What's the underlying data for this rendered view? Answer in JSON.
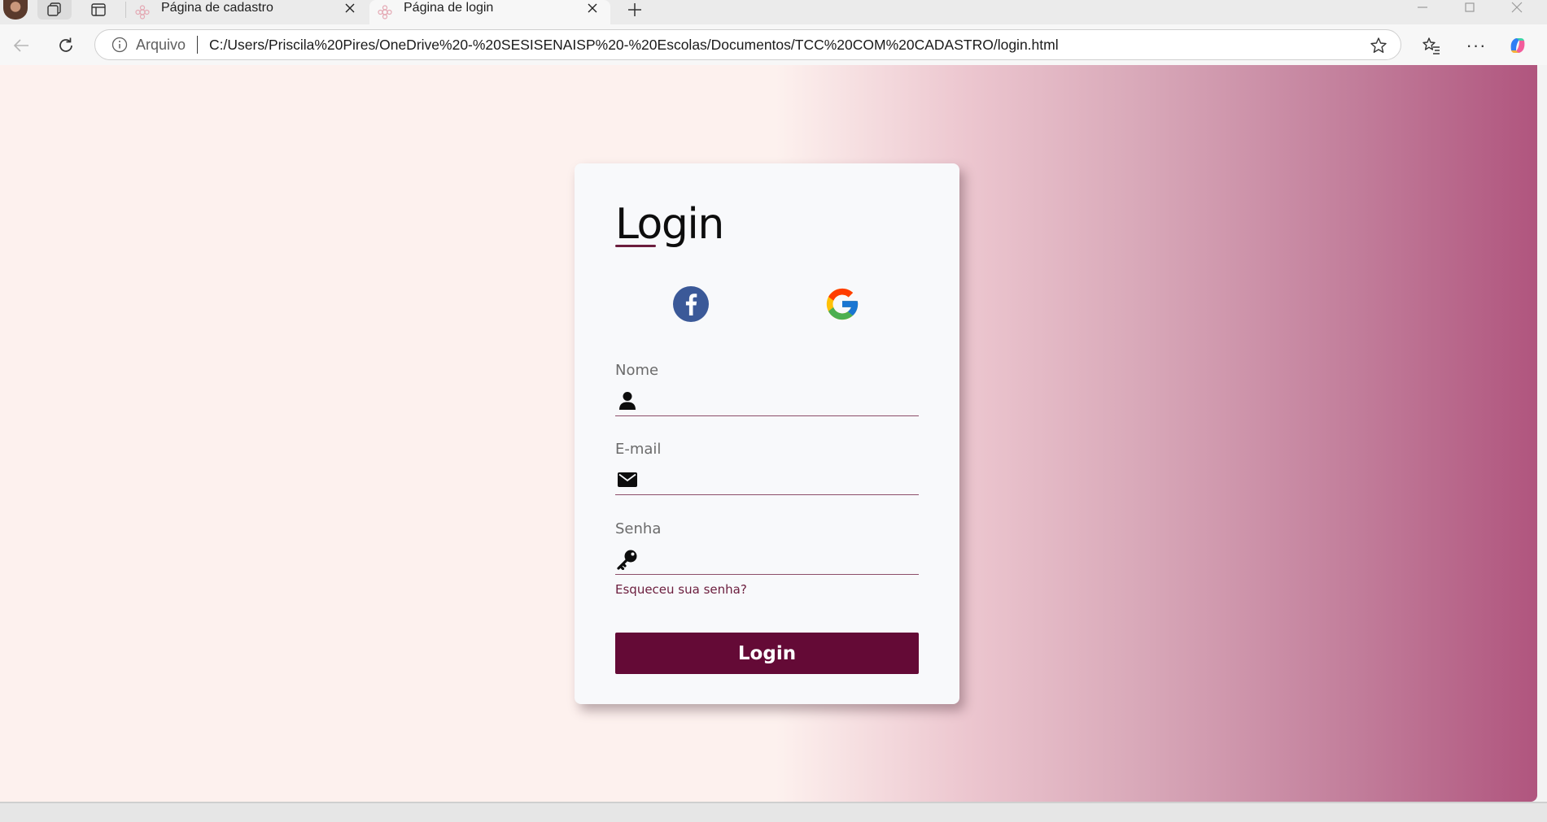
{
  "browser": {
    "tabs": [
      {
        "title": "Página de cadastro",
        "active": false
      },
      {
        "title": "Página de login",
        "active": true
      }
    ],
    "address": {
      "site_label": "Arquivo",
      "url": "C:/Users/Priscila%20Pires/OneDrive%20-%20SESISENAISP%20-%20Escolas/Documentos/TCC%20COM%20CADASTRO/login.html"
    },
    "more_label": "···"
  },
  "login_card": {
    "title": "Login",
    "social_buttons": [
      "facebook-icon",
      "google-icon"
    ],
    "fields": {
      "nome": {
        "label": "Nome",
        "value": "",
        "icon": "user-icon"
      },
      "email": {
        "label": "E-mail",
        "value": "",
        "icon": "envelope-icon"
      },
      "senha": {
        "label": "Senha",
        "value": "",
        "icon": "key-icon"
      }
    },
    "forgot_password": "Esqueceu sua senha?",
    "submit_label": "Login"
  },
  "colors": {
    "accent": "#640a36",
    "background_light": "#fdf1ee",
    "background_dark": "#b0557e",
    "facebook": "#3b5998"
  }
}
